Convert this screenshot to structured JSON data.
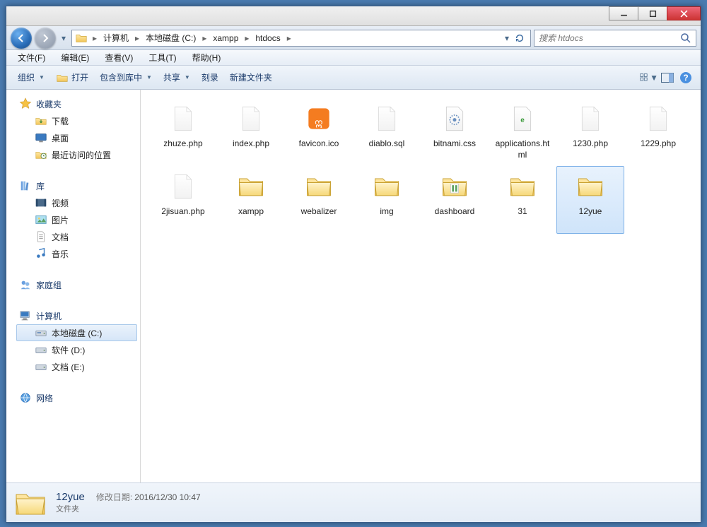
{
  "titlebar": {
    "min": "min",
    "max": "max",
    "close": "close"
  },
  "nav": {
    "back": "back",
    "forward": "forward"
  },
  "breadcrumb": [
    "计算机",
    "本地磁盘 (C:)",
    "xampp",
    "htdocs"
  ],
  "search": {
    "placeholder": "搜索 htdocs"
  },
  "menubar": [
    "文件(F)",
    "编辑(E)",
    "查看(V)",
    "工具(T)",
    "帮助(H)"
  ],
  "toolbar": {
    "organize": "组织",
    "open": "打开",
    "include": "包含到库中",
    "share": "共享",
    "burn": "刻录",
    "newfolder": "新建文件夹"
  },
  "sidebar": {
    "favorites": {
      "label": "收藏夹",
      "items": [
        "下载",
        "桌面",
        "最近访问的位置"
      ]
    },
    "libraries": {
      "label": "库",
      "items": [
        "视频",
        "图片",
        "文档",
        "音乐"
      ]
    },
    "homegroup": {
      "label": "家庭组"
    },
    "computer": {
      "label": "计算机",
      "items": [
        "本地磁盘 (C:)",
        "软件 (D:)",
        "文档 (E:)"
      ]
    },
    "network": {
      "label": "网络"
    }
  },
  "files": [
    {
      "name": "zhuze.php",
      "type": "file-blank"
    },
    {
      "name": "index.php",
      "type": "file-blank"
    },
    {
      "name": "favicon.ico",
      "type": "file-xampp"
    },
    {
      "name": "diablo.sql",
      "type": "file-blank"
    },
    {
      "name": "bitnami.css",
      "type": "file-css"
    },
    {
      "name": "applications.html",
      "type": "file-html"
    },
    {
      "name": "1230.php",
      "type": "file-blank"
    },
    {
      "name": "1229.php",
      "type": "file-blank"
    },
    {
      "name": "2jisuan.php",
      "type": "file-blank"
    },
    {
      "name": "xampp",
      "type": "folder"
    },
    {
      "name": "webalizer",
      "type": "folder"
    },
    {
      "name": "img",
      "type": "folder"
    },
    {
      "name": "dashboard",
      "type": "folder-dash"
    },
    {
      "name": "31",
      "type": "folder"
    },
    {
      "name": "12yue",
      "type": "folder",
      "selected": true
    }
  ],
  "details": {
    "name": "12yue",
    "type": "文件夹",
    "meta_label": "修改日期:",
    "meta_value": "2016/12/30 10:47"
  }
}
